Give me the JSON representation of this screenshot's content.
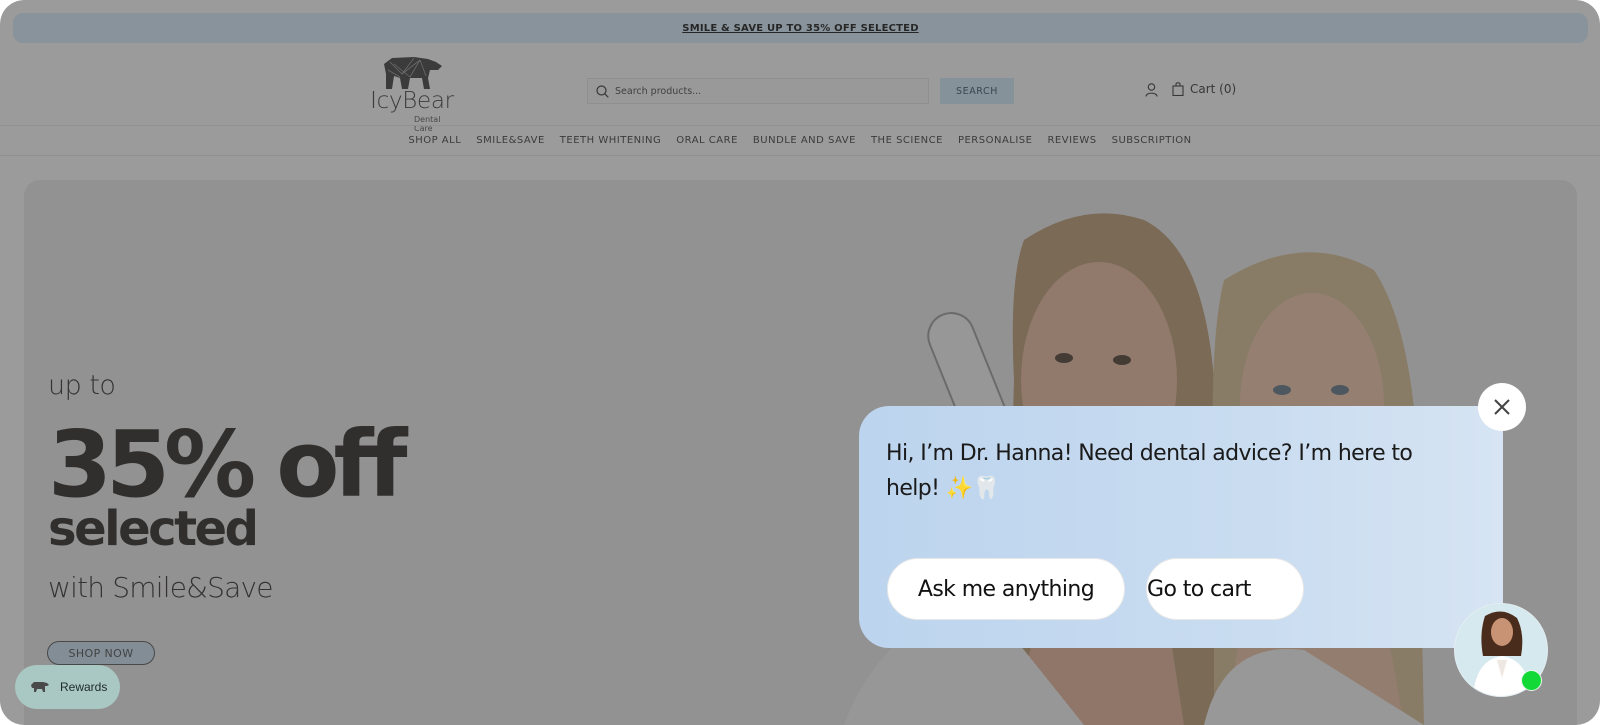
{
  "announcement": {
    "text": "SMILE & SAVE UP TO 35% OFF SELECTED"
  },
  "header": {
    "logo": {
      "brand": "IcyBear",
      "tagline": "Dental Care",
      "icon": "polygon-bear-icon"
    },
    "search": {
      "placeholder": "Search products...",
      "value": "",
      "button_label": "SEARCH",
      "icon": "search-icon"
    },
    "account_icon": "user-icon",
    "cart": {
      "label": "Cart (0)",
      "count": 0,
      "icon": "shopping-bag-icon"
    }
  },
  "nav": {
    "items": [
      {
        "label": "SHOP ALL"
      },
      {
        "label": "SMILE&SAVE"
      },
      {
        "label": "TEETH WHITENING"
      },
      {
        "label": "ORAL CARE"
      },
      {
        "label": "BUNDLE AND SAVE"
      },
      {
        "label": "THE SCIENCE"
      },
      {
        "label": "PERSONALISE"
      },
      {
        "label": "REVIEWS"
      },
      {
        "label": "SUBSCRIPTION"
      }
    ]
  },
  "hero": {
    "line1": "up to",
    "headline": "35% off",
    "line3": "selected",
    "line4": "with Smile&Save",
    "cta": "SHOP NOW",
    "image": "two-women-smiling-with-whitening-device"
  },
  "rewards": {
    "label": "Rewards",
    "icon": "bear-icon"
  },
  "chat": {
    "message": "Hi, I’m Dr. Hanna! Need dental advice? I’m here to help! ✨🦷",
    "buttons": [
      {
        "label": "Ask me anything"
      },
      {
        "label": "Go to cart"
      }
    ],
    "close_icon": "close-icon",
    "agent_status": "online",
    "colors": {
      "status": "#12d936",
      "bubble": "#c9dcf0"
    }
  },
  "colors": {
    "announcement_bg": "#d7ebfa",
    "search_button_bg": "#cfe8f8"
  }
}
